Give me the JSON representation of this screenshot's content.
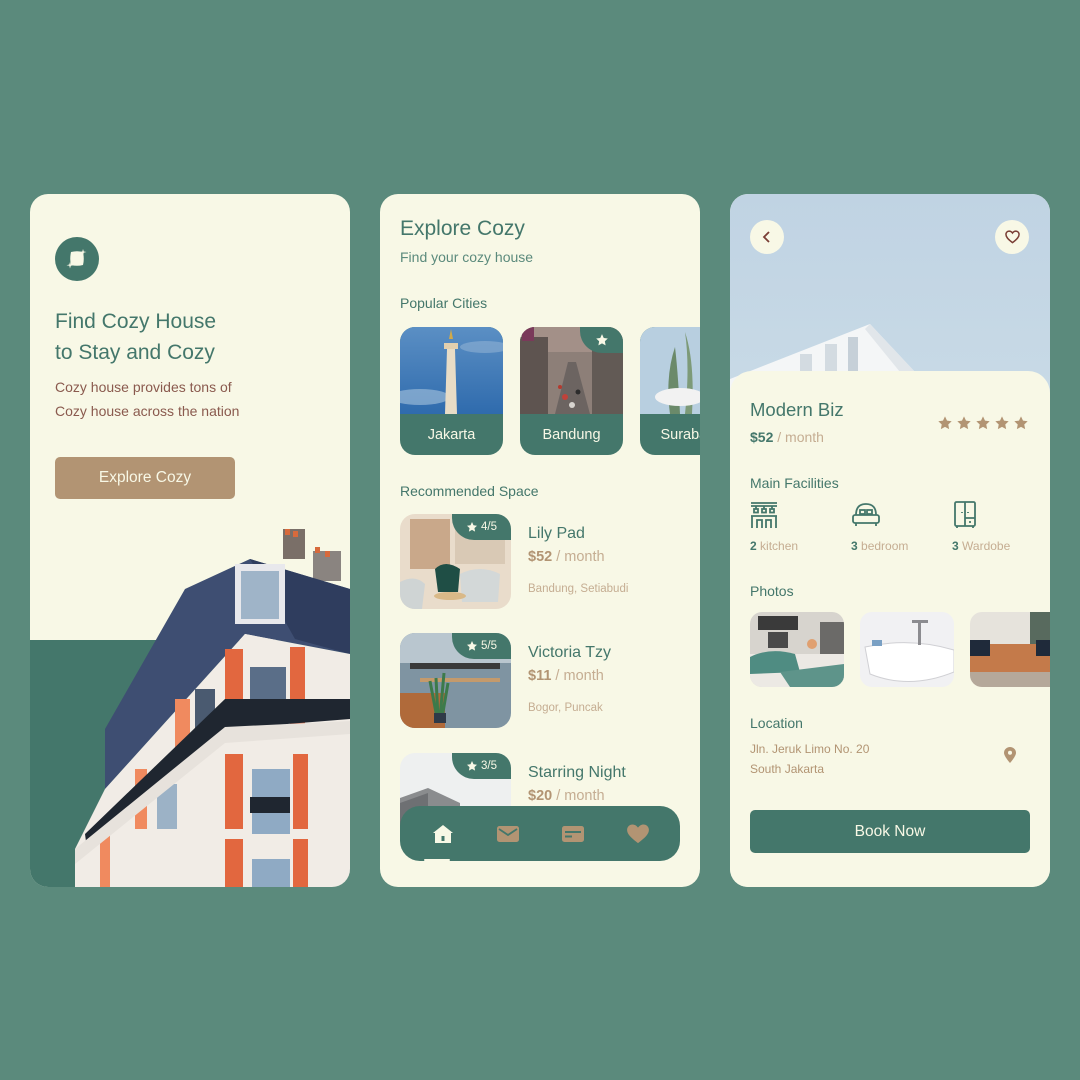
{
  "colors": {
    "background": "#5b8a7c",
    "card": "#f8f8e6",
    "primary_green": "#44776b",
    "accent_brown": "#b29473",
    "muted_brown": "#c5ad92",
    "description_text": "#8a5a4e"
  },
  "onboarding": {
    "logo_icon": "sparkle-square-logo",
    "title_line1": "Find Cozy House",
    "title_line2": "to Stay and Cozy",
    "description_line1": "Cozy house provides tons of",
    "description_line2": "Cozy house across the nation",
    "cta_label": "Explore Cozy"
  },
  "explore": {
    "title": "Explore Cozy",
    "subtitle": "Find your cozy house",
    "popular_label": "Popular Cities",
    "cities": [
      {
        "name": "Jakarta",
        "featured": false
      },
      {
        "name": "Bandung",
        "featured": true
      },
      {
        "name": "Surabaya",
        "featured": false
      }
    ],
    "recommended_label": "Recommended Space",
    "spaces": [
      {
        "name": "Lily Pad",
        "price": "$52",
        "period": " / month",
        "location": "Bandung, Setiabudi",
        "rating": "4/5"
      },
      {
        "name": "Victoria Tzy",
        "price": "$11",
        "period": " / month",
        "location": "Bogor, Puncak",
        "rating": "5/5"
      },
      {
        "name": "Starring Night",
        "price": "$20",
        "period": " / month",
        "location": "",
        "rating": "3/5"
      }
    ],
    "nav": [
      {
        "icon": "home-icon",
        "active": true
      },
      {
        "icon": "mail-icon",
        "active": false
      },
      {
        "icon": "card-icon",
        "active": false
      },
      {
        "icon": "heart-icon",
        "active": false
      }
    ]
  },
  "detail": {
    "name": "Modern Biz",
    "price": "$52",
    "period": " / month",
    "rating_stars": 5,
    "rating_max": 5,
    "facilities_label": "Main Facilities",
    "facilities": [
      {
        "count": "2",
        "label": " kitchen",
        "icon": "kitchen-icon"
      },
      {
        "count": "3",
        "label": " bedroom",
        "icon": "bed-icon"
      },
      {
        "count": "3",
        "label": " Wardobe",
        "icon": "wardrobe-icon"
      }
    ],
    "photos_label": "Photos",
    "photos": [
      "bedroom-photo",
      "bathtub-photo",
      "living-room-photo"
    ],
    "location_label": "Location",
    "address_line1": "Jln. Jeruk Limo No. 20",
    "address_line2": "South Jakarta",
    "book_label": "Book Now"
  }
}
